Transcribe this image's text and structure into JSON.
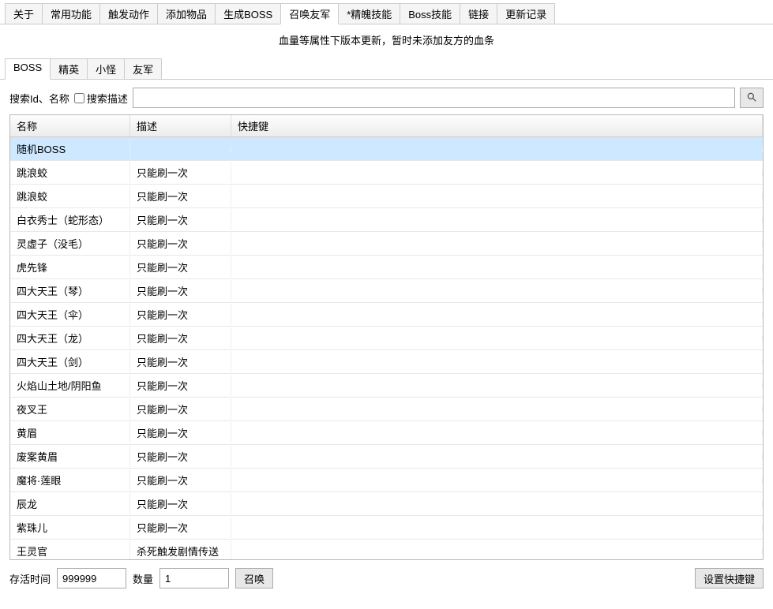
{
  "topTabs": [
    "关于",
    "常用功能",
    "触发动作",
    "添加物品",
    "生成BOSS",
    "召唤友军",
    "*精魄技能",
    "Boss技能",
    "链接",
    "更新记录"
  ],
  "topActiveIndex": 5,
  "notice": "血量等属性下版本更新，暂时未添加友方的血条",
  "subTabs": [
    "BOSS",
    "精英",
    "小怪",
    "友军"
  ],
  "subActiveIndex": 0,
  "search": {
    "label": "搜索Id、名称",
    "descCheckboxLabel": "搜索描述",
    "value": ""
  },
  "table": {
    "headers": [
      "名称",
      "描述",
      "快捷键"
    ],
    "rows": [
      {
        "name": "随机BOSS",
        "desc": "",
        "key": ""
      },
      {
        "name": "跳浪蛟",
        "desc": "只能刷一次",
        "key": ""
      },
      {
        "name": "跳浪蛟",
        "desc": "只能刷一次",
        "key": ""
      },
      {
        "name": "白衣秀士（蛇形态）",
        "desc": "只能刷一次",
        "key": ""
      },
      {
        "name": "灵虚子（没毛）",
        "desc": "只能刷一次",
        "key": ""
      },
      {
        "name": "虎先锋",
        "desc": "只能刷一次",
        "key": ""
      },
      {
        "name": "四大天王（琴）",
        "desc": "只能刷一次",
        "key": ""
      },
      {
        "name": "四大天王（伞）",
        "desc": "只能刷一次",
        "key": ""
      },
      {
        "name": "四大天王（龙）",
        "desc": "只能刷一次",
        "key": ""
      },
      {
        "name": "四大天王（剑）",
        "desc": "只能刷一次",
        "key": ""
      },
      {
        "name": "火焰山土地/阴阳鱼",
        "desc": "只能刷一次",
        "key": ""
      },
      {
        "name": "夜叉王",
        "desc": "只能刷一次",
        "key": ""
      },
      {
        "name": "黄眉",
        "desc": "只能刷一次",
        "key": ""
      },
      {
        "name": "废案黄眉",
        "desc": "只能刷一次",
        "key": ""
      },
      {
        "name": "魔将·莲眼",
        "desc": "只能刷一次",
        "key": ""
      },
      {
        "name": "辰龙",
        "desc": "只能刷一次",
        "key": ""
      },
      {
        "name": "紫珠儿",
        "desc": "只能刷一次",
        "key": ""
      },
      {
        "name": "王灵官",
        "desc": "杀死触发剧情传送",
        "key": ""
      }
    ],
    "selectedIndex": 0
  },
  "bottom": {
    "lifeLabel": "存活时间",
    "lifeValue": "999999",
    "qtyLabel": "数量",
    "qtyValue": "1",
    "summonBtn": "召唤",
    "hotkeyBtn": "设置快捷键"
  }
}
